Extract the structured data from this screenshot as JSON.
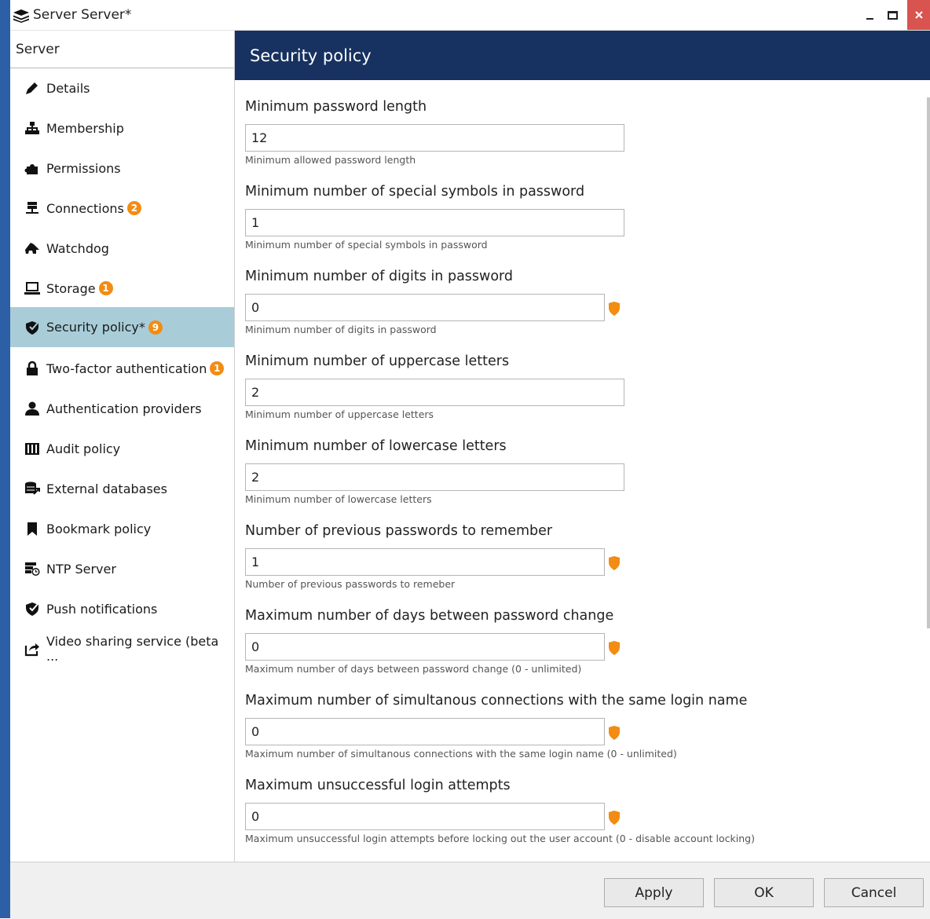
{
  "window": {
    "title": "Server Server*",
    "minimize_icon": "minimize-icon",
    "maximize_icon": "maximize-icon",
    "close_icon": "close-icon",
    "app_icon": "server-stack-icon"
  },
  "sidebar": {
    "header": "Server",
    "items": [
      {
        "label": "Details",
        "icon": "pencil-icon",
        "badge": null
      },
      {
        "label": "Membership",
        "icon": "hierarchy-icon",
        "badge": null
      },
      {
        "label": "Permissions",
        "icon": "puzzle-icon",
        "badge": null
      },
      {
        "label": "Connections",
        "icon": "connections-icon",
        "badge": "2"
      },
      {
        "label": "Watchdog",
        "icon": "watchdog-icon",
        "badge": null
      },
      {
        "label": "Storage",
        "icon": "storage-icon",
        "badge": "1"
      },
      {
        "label": "Security policy*",
        "icon": "security-policy-icon",
        "badge": "9",
        "active": true
      },
      {
        "label": "Two-factor authentication",
        "icon": "lock-icon",
        "badge": "1"
      },
      {
        "label": "Authentication providers",
        "icon": "user-icon",
        "badge": null
      },
      {
        "label": "Audit policy",
        "icon": "book-icon",
        "badge": null
      },
      {
        "label": "External databases",
        "icon": "database-icon",
        "badge": null
      },
      {
        "label": "Bookmark policy",
        "icon": "bookmark-icon",
        "badge": null
      },
      {
        "label": "NTP Server",
        "icon": "ntp-server-icon",
        "badge": null
      },
      {
        "label": "Push notifications",
        "icon": "push-icon",
        "badge": null
      },
      {
        "label": "Video sharing service (beta ...",
        "icon": "share-icon",
        "badge": null
      }
    ]
  },
  "content": {
    "title": "Security policy",
    "fields": [
      {
        "label": "Minimum password length",
        "value": "12",
        "help": "Minimum allowed password length",
        "shield": false
      },
      {
        "label": "Minimum number of special symbols in password",
        "value": "1",
        "help": "Minimum number of special symbols in password",
        "shield": false
      },
      {
        "label": "Minimum number of digits in password",
        "value": "0",
        "help": "Minimum number of digits in password",
        "shield": true
      },
      {
        "label": "Minimum number of uppercase letters",
        "value": "2",
        "help": "Minimum number of uppercase letters",
        "shield": false
      },
      {
        "label": "Minimum number of lowercase letters",
        "value": "2",
        "help": "Minimum number of lowercase letters",
        "shield": false
      },
      {
        "label": "Number of previous passwords to remember",
        "value": "1",
        "help": "Number of previous passwords to remeber",
        "shield": true
      },
      {
        "label": "Maximum number of days between password change",
        "value": "0",
        "help": "Maximum number of days between password change (0 - unlimited)",
        "shield": true
      },
      {
        "label": "Maximum number of simultanous connections with the same login name",
        "value": "0",
        "help": "Maximum number of simultanous connections with the same login name (0 - unlimited)",
        "shield": true
      },
      {
        "label": "Maximum unsuccessful login attempts",
        "value": "0",
        "help": "Maximum unsuccessful login attempts before locking out the user account (0 - disable account locking)",
        "shield": true
      }
    ]
  },
  "footer": {
    "apply": "Apply",
    "ok": "OK",
    "cancel": "Cancel"
  },
  "colors": {
    "header_bg": "#173260",
    "active_item_bg": "#a8cdd9",
    "badge": "#f28c12",
    "shield": "#f28c12",
    "close_button": "#d9534f"
  }
}
